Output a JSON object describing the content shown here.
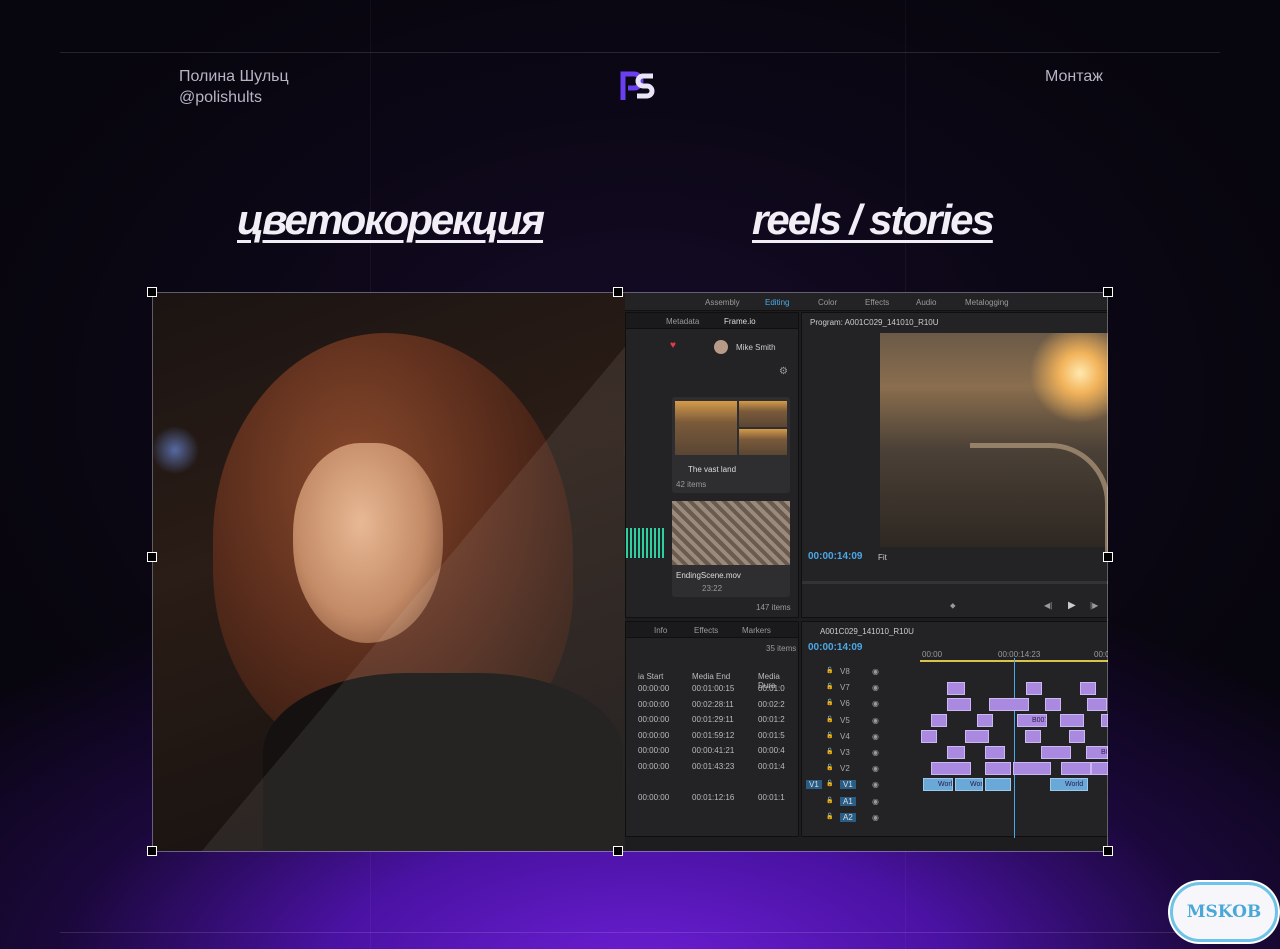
{
  "header": {
    "author_name": "Полина Шульц",
    "author_handle": "@polishults",
    "category": "Монтаж"
  },
  "sections": {
    "left_title": "цветокорекция",
    "right_title": "reels / stories"
  },
  "premiere": {
    "workspaces": [
      "Assembly",
      "Editing",
      "Color",
      "Effects",
      "Audio",
      "Metalogging"
    ],
    "active_workspace": "Editing",
    "project_tabs": {
      "metadata": "Metadata",
      "frameio": "Frame.io"
    },
    "user_name": "Mike Smith",
    "program_title": "Program: A001C029_141010_R10U",
    "program_timecode": "00:00:14:09",
    "fit_label": "Fit",
    "cards": [
      {
        "name": "The vast land",
        "meta": "42 items"
      },
      {
        "name": "EndingScene.mov",
        "meta": "23:22"
      }
    ],
    "items_count": "147 items",
    "lower_tabs": [
      "Info",
      "Effects",
      "Markers"
    ],
    "list_count": "35 items",
    "list_headers": [
      "ia Start",
      "Media End",
      "Media Dura"
    ],
    "list_rows": [
      [
        "00:00:00",
        "00:01:00:15",
        "00:01:0"
      ],
      [
        "00:00:00",
        "00:02:28:11",
        "00:02:2"
      ],
      [
        "00:00:00",
        "00:01:29:11",
        "00:01:2"
      ],
      [
        "00:00:00",
        "00:01:59:12",
        "00:01:5"
      ],
      [
        "00:00:00",
        "00:00:41:21",
        "00:00:4"
      ],
      [
        "00:00:00",
        "00:01:43:23",
        "00:01:4"
      ],
      [
        "00:00:00",
        "00:01:12:16",
        "00:01:1"
      ]
    ],
    "sequence_title": "A001C029_141010_R10U",
    "sequence_timecode": "00:00:14:09",
    "ruler": [
      "00:00",
      "00:00:14:23",
      "00:0"
    ],
    "tracks": [
      "V8",
      "V7",
      "V6",
      "V5",
      "V4",
      "V3",
      "V2",
      "V1",
      "A1",
      "A2"
    ],
    "clip_labels": {
      "b007": "B007",
      "b007b": "B007",
      "world": "Worl",
      "world2": "Wor",
      "world3": "World"
    },
    "a_track_flags": {
      "m": "M",
      "s": "S"
    },
    "v1_source": "V1"
  },
  "watermark": "MSKOB",
  "colors": {
    "accent": "#6d1fd6",
    "premiere_blue": "#4aa8e8",
    "clip_purple": "#a98ae0"
  }
}
